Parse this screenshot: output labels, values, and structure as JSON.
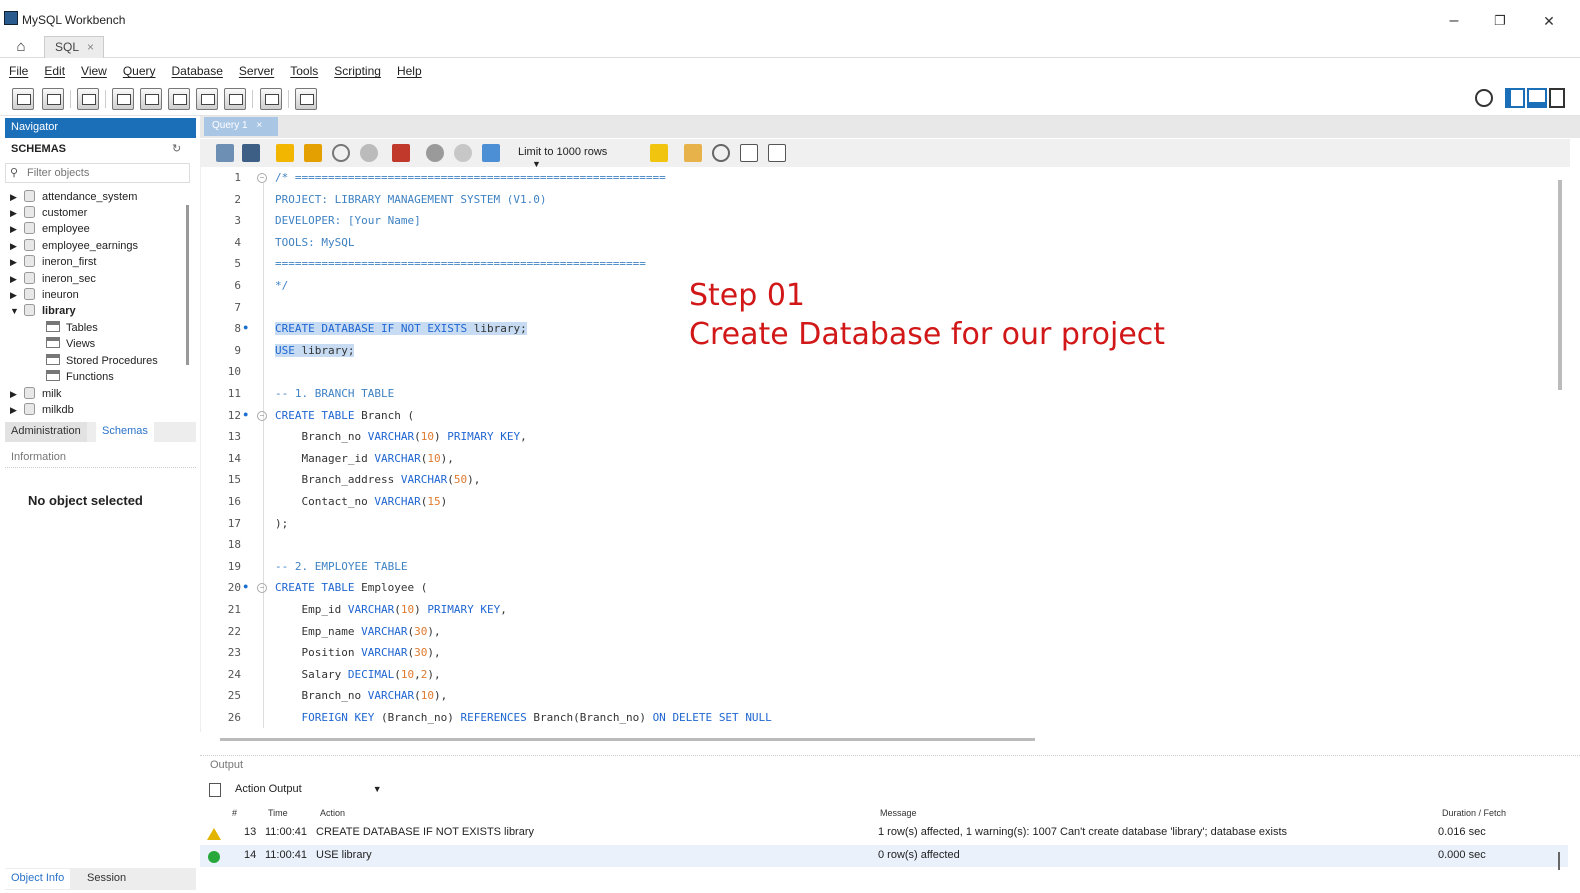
{
  "window": {
    "title": "MySQL Workbench",
    "minimize": "–",
    "restore": "❐",
    "close": "✕"
  },
  "tabs": {
    "home_icon": "home-icon",
    "sql_tab": "SQL",
    "sql_tab_close": "×"
  },
  "menu": [
    "File",
    "Edit",
    "View",
    "Query",
    "Database",
    "Server",
    "Tools",
    "Scripting",
    "Help"
  ],
  "navigator": {
    "header": "Navigator",
    "schemas_title": "SCHEMAS",
    "filter_placeholder": "Filter objects",
    "schemas": [
      "attendance_system",
      "customer",
      "employee",
      "employee_earnings",
      "ineron_first",
      "ineron_sec",
      "ineuron",
      "library",
      "milk",
      "milkdb"
    ],
    "library_children": [
      "Tables",
      "Views",
      "Stored Procedures",
      "Functions"
    ],
    "tabs": [
      "Administration",
      "Schemas"
    ],
    "info_header": "Information",
    "no_object": "No object selected",
    "bottom_tabs": [
      "Object Info",
      "Session"
    ]
  },
  "query_tab": {
    "label": "Query 1",
    "close": "×",
    "limit": "Limit to 1000 rows"
  },
  "editor": {
    "lines": [
      {
        "n": "1",
        "text": "/* ========================================================"
      },
      {
        "n": "2",
        "text": "PROJECT: LIBRARY MANAGEMENT SYSTEM (V1.0)"
      },
      {
        "n": "3",
        "text": "DEVELOPER: [Your Name]"
      },
      {
        "n": "4",
        "text": "TOOLS: MySQL"
      },
      {
        "n": "5",
        "text": "========================================================"
      },
      {
        "n": "6",
        "text": "*/"
      },
      {
        "n": "7",
        "text": ""
      },
      {
        "n": "8",
        "text": "CREATE DATABASE IF NOT EXISTS library;"
      },
      {
        "n": "9",
        "text": "USE library;"
      },
      {
        "n": "10",
        "text": ""
      },
      {
        "n": "11",
        "text": "-- 1. BRANCH TABLE"
      },
      {
        "n": "12",
        "text": "CREATE TABLE Branch ("
      },
      {
        "n": "13",
        "text": "    Branch_no VARCHAR(10) PRIMARY KEY,"
      },
      {
        "n": "14",
        "text": "    Manager_id VARCHAR(10),"
      },
      {
        "n": "15",
        "text": "    Branch_address VARCHAR(50),"
      },
      {
        "n": "16",
        "text": "    Contact_no VARCHAR(15)"
      },
      {
        "n": "17",
        "text": ");"
      },
      {
        "n": "18",
        "text": ""
      },
      {
        "n": "19",
        "text": "-- 2. EMPLOYEE TABLE"
      },
      {
        "n": "20",
        "text": "CREATE TABLE Employee ("
      },
      {
        "n": "21",
        "text": "    Emp_id VARCHAR(10) PRIMARY KEY,"
      },
      {
        "n": "22",
        "text": "    Emp_name VARCHAR(30),"
      },
      {
        "n": "23",
        "text": "    Position VARCHAR(30),"
      },
      {
        "n": "24",
        "text": "    Salary DECIMAL(10,2),"
      },
      {
        "n": "25",
        "text": "    Branch_no VARCHAR(10),"
      },
      {
        "n": "26",
        "text": "    FOREIGN KEY (Branch_no) REFERENCES Branch(Branch_no) ON DELETE SET NULL"
      }
    ],
    "overlay": {
      "line1": "Step 01",
      "line2": "Create Database for our project",
      "color": "#d11717"
    }
  },
  "output": {
    "header": "Output",
    "mode": "Action Output",
    "columns": [
      "#",
      "Time",
      "Action",
      "Message",
      "Duration / Fetch"
    ],
    "rows": [
      {
        "status": "warning",
        "num": "13",
        "time": "11:00:41",
        "action": "CREATE DATABASE IF NOT EXISTS library",
        "message": "1 row(s) affected, 1 warning(s): 1007 Can't create database 'library'; database exists",
        "duration": "0.016 sec"
      },
      {
        "status": "success",
        "num": "14",
        "time": "11:00:41",
        "action": "USE library",
        "message": "0 row(s) affected",
        "duration": "0.000 sec"
      }
    ]
  }
}
